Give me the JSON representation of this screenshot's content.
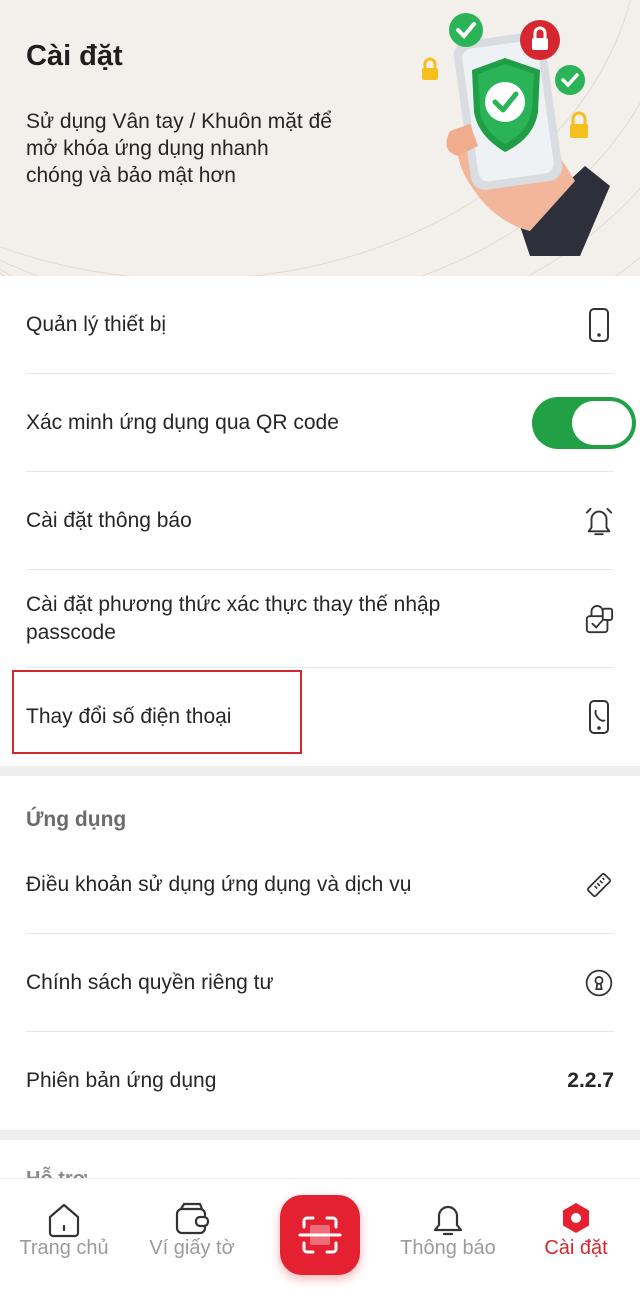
{
  "header": {
    "title": "Cài đặt",
    "subtitle": "Sử dụng Vân tay / Khuôn mặt để\nmở  khóa ứng dụng nhanh\nchóng và bảo mật hơn"
  },
  "security": {
    "items": [
      {
        "label": "Quản lý thiết bị",
        "icon": "phone-icon"
      },
      {
        "label": "Xác minh ứng dụng qua QR code",
        "control": "toggle",
        "toggle_on": true
      },
      {
        "label": "Cài đặt thông báo",
        "icon": "alarm-bell-icon"
      },
      {
        "label": "Cài đặt phương thức xác thực thay thế nhập passcode",
        "icon": "lock-check-icon"
      },
      {
        "label": "Thay đổi số điện thoại",
        "icon": "phone-call-icon",
        "highlighted": true
      }
    ]
  },
  "app": {
    "section_title": "Ứng dụng",
    "items": [
      {
        "label": "Điều khoản sử dụng ứng dụng và dịch vụ",
        "icon": "ruler-icon"
      },
      {
        "label": "Chính sách quyền riêng tư",
        "icon": "keyhole-icon"
      },
      {
        "label": "Phiên bản ứng dụng",
        "value": "2.2.7"
      }
    ]
  },
  "partial_section_text": "Hỗ trợ",
  "tabbar": {
    "tabs": [
      {
        "label": "Trang chủ",
        "icon": "home-icon",
        "active": false
      },
      {
        "label": "Ví giấy tờ",
        "icon": "wallet-icon",
        "active": false
      },
      {
        "label": "",
        "icon": "scan-icon",
        "center": true
      },
      {
        "label": "Thông báo",
        "icon": "bell-icon",
        "active": false
      },
      {
        "label": "Cài đặt",
        "icon": "settings-icon",
        "active": true
      }
    ]
  },
  "colors": {
    "accent_red": "#d6262f",
    "scan_button_red": "#e42131",
    "toggle_green": "#22a046",
    "header_bg": "#f3efea"
  }
}
